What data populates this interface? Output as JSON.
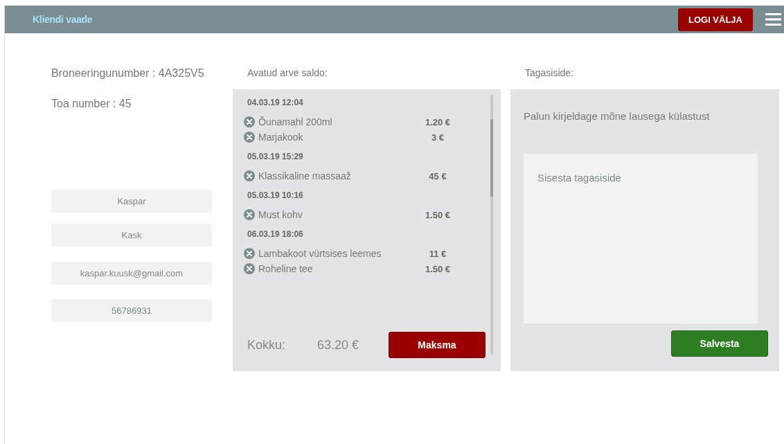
{
  "header": {
    "title": "Kliendi vaade",
    "logout": "LOGI VÄLJA"
  },
  "booking": {
    "booking_number": "Broneeringunumber : 4A325V5",
    "room_number": "Toa number : 45",
    "fields": [
      {
        "value": "Kaspar"
      },
      {
        "value": "Kask"
      },
      {
        "value": "kaspar.kuusk@gmail.com"
      },
      {
        "value": "56786931"
      }
    ]
  },
  "bill": {
    "heading": "Avatud arve saldo:",
    "groups": [
      {
        "date": "04.03.19 12:04",
        "items": [
          {
            "name": "Õunamahl 200ml",
            "price": "1.20 €"
          },
          {
            "name": "Marjakook",
            "price": "3 €"
          }
        ]
      },
      {
        "date": "05.03.19 15:29",
        "items": [
          {
            "name": "Klassikaline massaaž",
            "price": "45 €"
          }
        ]
      },
      {
        "date": "05.03.19 10:16",
        "items": [
          {
            "name": "Must kohv",
            "price": "1.50 €"
          }
        ]
      },
      {
        "date": "06.03.19 18:06",
        "items": [
          {
            "name": "Lambakoot vürtsises leemes",
            "price": "11 €"
          },
          {
            "name": "Roheline tee",
            "price": "1.50 €"
          }
        ]
      }
    ],
    "total_label": "Kokku:",
    "total": "63.20 €",
    "pay_button": "Maksma"
  },
  "feedback": {
    "heading": "Tagasiside:",
    "prompt": "Palun kirjeldage mõne lausega külastust",
    "placeholder": "Sisesta tagasiside",
    "save_button": "Salvesta"
  }
}
